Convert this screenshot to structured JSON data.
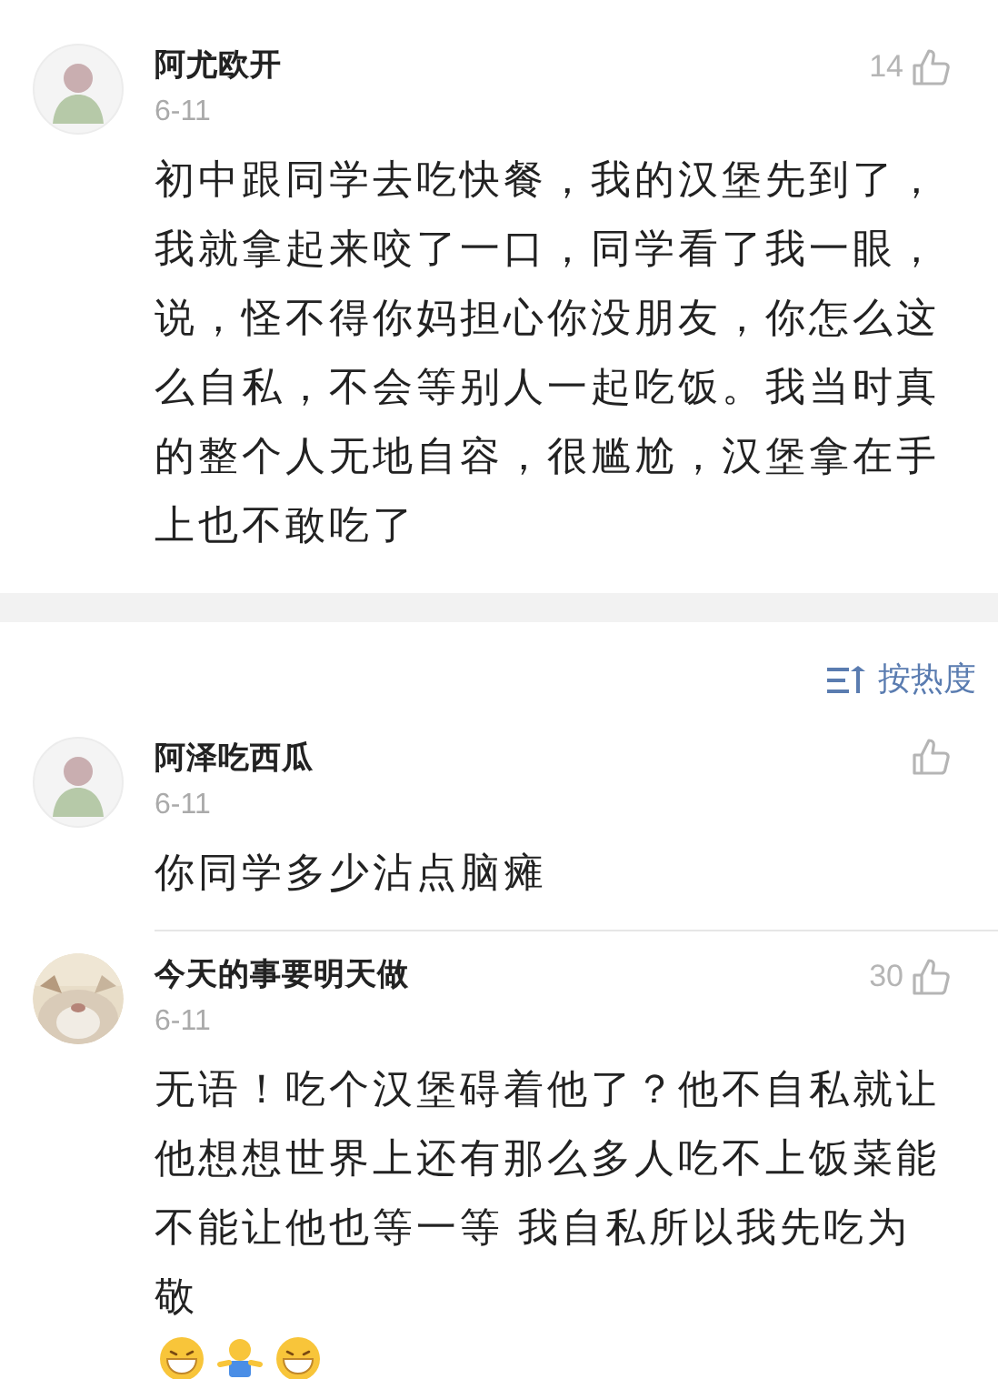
{
  "top_comment": {
    "name": "阿尤欧开",
    "date": "6-11",
    "likes": "14",
    "text": "初中跟同学去吃快餐，我的汉堡先到了，我就拿起来咬了一口，同学看了我一眼，说，怪不得你妈担心你没朋友，你怎么这么自私，不会等别人一起吃饭。我当时真的整个人无地自容，很尴尬，汉堡拿在手上也不敢吃了",
    "avatar": {
      "kind": "icon"
    }
  },
  "sort": {
    "label": "按热度"
  },
  "replies": [
    {
      "name": "阿泽吃西瓜",
      "date": "6-11",
      "text": "你同学多少沾点脑瘫",
      "avatar": {
        "kind": "icon"
      }
    },
    {
      "name": "今天的事要明天做",
      "date": "6-11",
      "likes": "30",
      "text": "无语！吃个汉堡碍着他了？他不自私就让他想想世界上还有那么多人吃不上饭菜能不能让他也等一等  我自私所以我先吃为敬",
      "emojis": [
        {
          "kind": "grin"
        },
        {
          "kind": "figure"
        },
        {
          "kind": "grin"
        }
      ]
    }
  ]
}
